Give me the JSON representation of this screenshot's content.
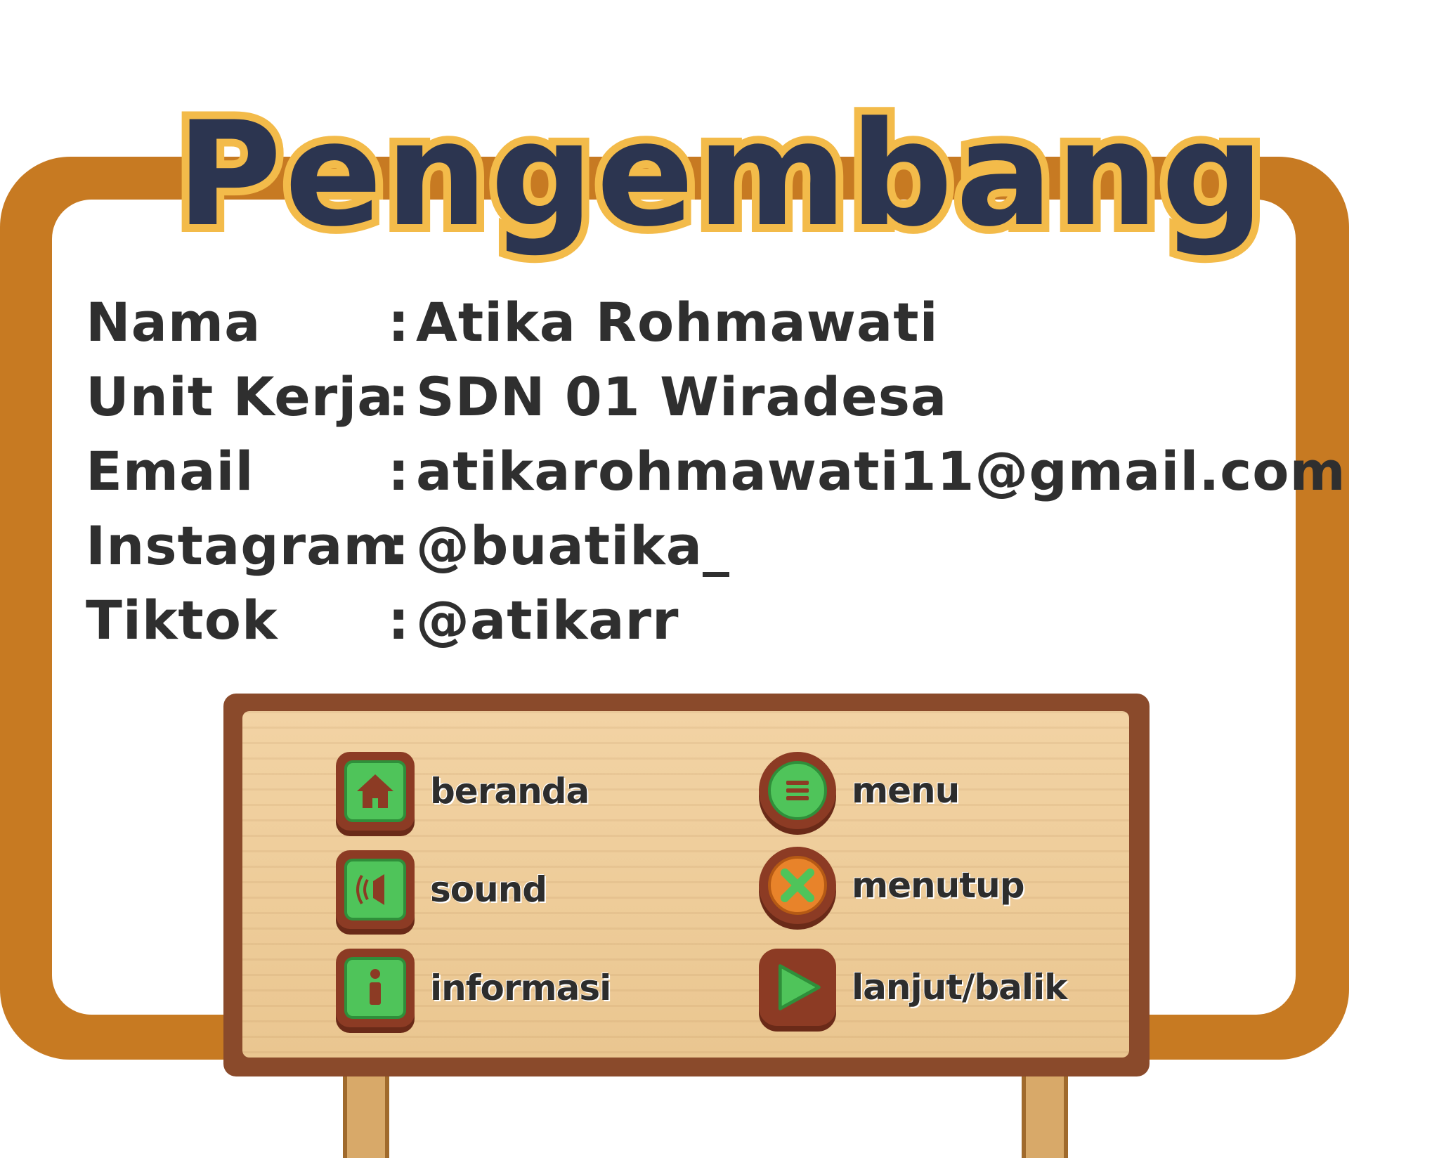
{
  "title": "Pengembang",
  "info": [
    {
      "key": "Nama",
      "sep": ":",
      "value": "Atika Rohmawati"
    },
    {
      "key": "Unit Kerja",
      "sep": ":",
      "value": "SDN 01 Wiradesa"
    },
    {
      "key": "Email",
      "sep": ":",
      "value": "atikarohmawati11@gmail.com"
    },
    {
      "key": "Instagram",
      "sep": ":",
      "value": "@buatika_"
    },
    {
      "key": "Tiktok",
      "sep": ":",
      "value": "@atikarr"
    }
  ],
  "legend": {
    "beranda": {
      "label": "beranda",
      "icon": "home-icon"
    },
    "sound": {
      "label": "sound",
      "icon": "speaker-icon"
    },
    "informasi": {
      "label": "informasi",
      "icon": "info-icon"
    },
    "menu": {
      "label": "menu",
      "icon": "hamburger-icon"
    },
    "menutup": {
      "label": "menutup",
      "icon": "close-icon"
    },
    "lanjut": {
      "label": "lanjut/balik",
      "icon": "play-arrow-icon"
    }
  },
  "colors": {
    "frame": "#c77a22",
    "title_fill": "#2c3550",
    "title_outline": "#f3bb4a",
    "text": "#2f2f2f",
    "button_green": "#4fc45a",
    "button_wood": "#8c3b24",
    "close_orange": "#e8832a",
    "board": "#f2d3a4"
  }
}
